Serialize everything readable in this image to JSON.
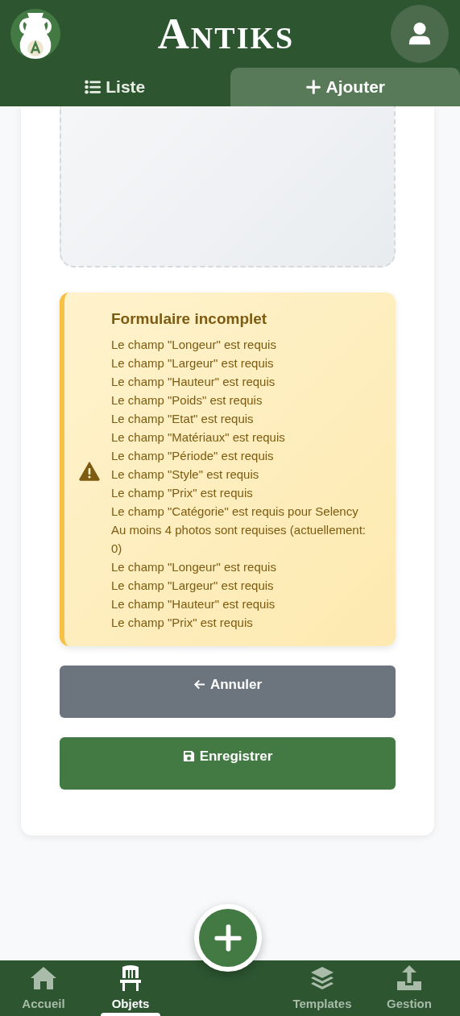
{
  "header": {
    "title": "Antiks"
  },
  "tabs": [
    {
      "label": "Liste",
      "selected": false
    },
    {
      "label": "Ajouter",
      "selected": true
    }
  ],
  "alert": {
    "title": "Formulaire incomplet",
    "messages": [
      "Le champ \"Longeur\" est requis",
      "Le champ \"Largeur\" est requis",
      "Le champ \"Hauteur\" est requis",
      "Le champ \"Poids\" est requis",
      "Le champ \"Etat\" est requis",
      "Le champ \"Matériaux\" est requis",
      "Le champ \"Période\" est requis",
      "Le champ \"Style\" est requis",
      "Le champ \"Prix\" est requis",
      "Le champ \"Catégorie\" est requis pour Selency",
      "Au moins 4 photos sont requises (actuellement: 0)",
      "Le champ \"Longeur\" est requis",
      "Le champ \"Largeur\" est requis",
      "Le champ \"Hauteur\" est requis",
      "Le champ \"Prix\" est requis"
    ]
  },
  "buttons": [
    {
      "label": "Annuler",
      "kind": "cancel"
    },
    {
      "label": "Enregistrer",
      "kind": "save"
    }
  ],
  "nav": [
    {
      "label": "Accueil",
      "selected": false
    },
    {
      "label": "Objets",
      "selected": true
    },
    {
      "label": "Templates",
      "selected": false
    },
    {
      "label": "Gestion",
      "selected": false
    }
  ]
}
